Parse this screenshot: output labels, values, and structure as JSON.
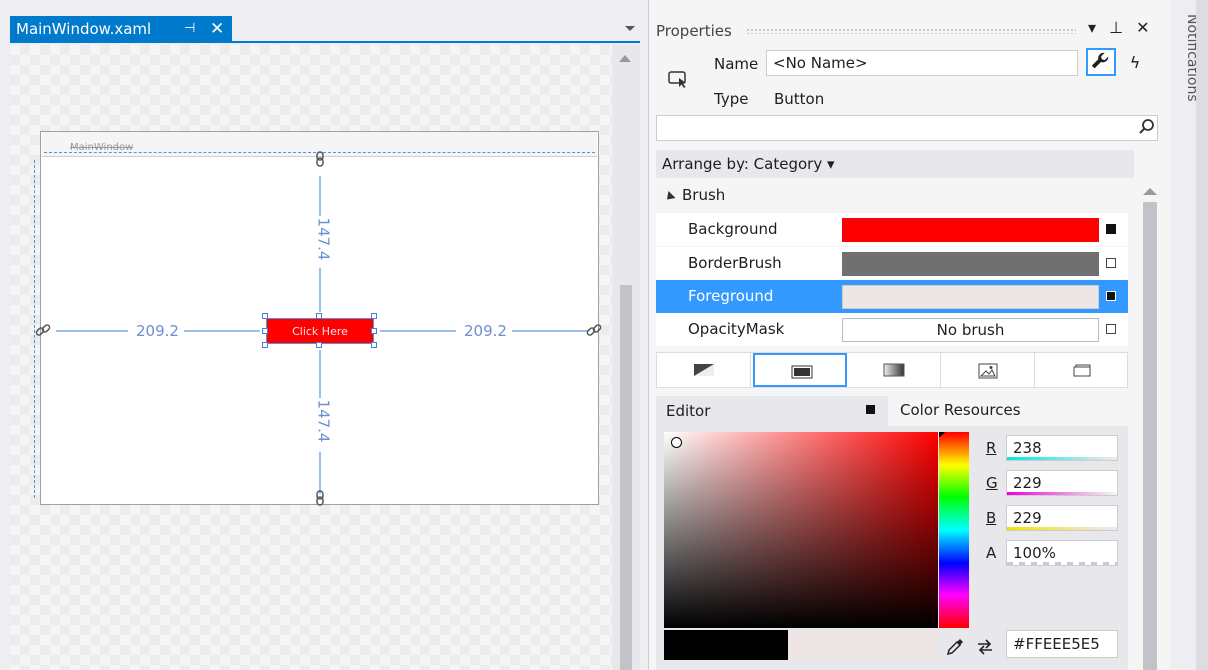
{
  "document_tab": {
    "title": "MainWindow.xaml",
    "pin_icon": "pin-icon",
    "close_icon": "close-icon"
  },
  "designer": {
    "window_title": "MainWindow",
    "button_label": "Click Here",
    "button_background": "#FF0000",
    "margins": {
      "left": "209.2",
      "right": "209.2",
      "top": "147.4",
      "bottom": "147.4"
    }
  },
  "properties": {
    "title": "Properties",
    "name_label": "Name",
    "name_value": "<No Name>",
    "type_label": "Type",
    "type_value": "Button",
    "arrange_by": "Arrange by: Category",
    "category": "Brush",
    "rows": [
      {
        "label": "Background",
        "color": "#FF0000"
      },
      {
        "label": "BorderBrush",
        "color": "#707070"
      },
      {
        "label": "Foreground",
        "color": "#EEE5E5"
      },
      {
        "label": "OpacityMask",
        "value": "No brush"
      }
    ],
    "brush_tabs": [
      "no-brush-icon",
      "solid-color-brush-icon",
      "gradient-brush-icon",
      "image-brush-icon",
      "visual-brush-icon"
    ],
    "editor_tab": "Editor",
    "color_resources_tab": "Color Resources",
    "channels": {
      "r_label": "R",
      "r_value": "238",
      "g_label": "G",
      "g_value": "229",
      "b_label": "B",
      "b_value": "229",
      "a_label": "A",
      "a_value": "100%"
    },
    "hex_value": "#FFEEE5E5"
  },
  "notifications": {
    "label": "Notifications"
  }
}
